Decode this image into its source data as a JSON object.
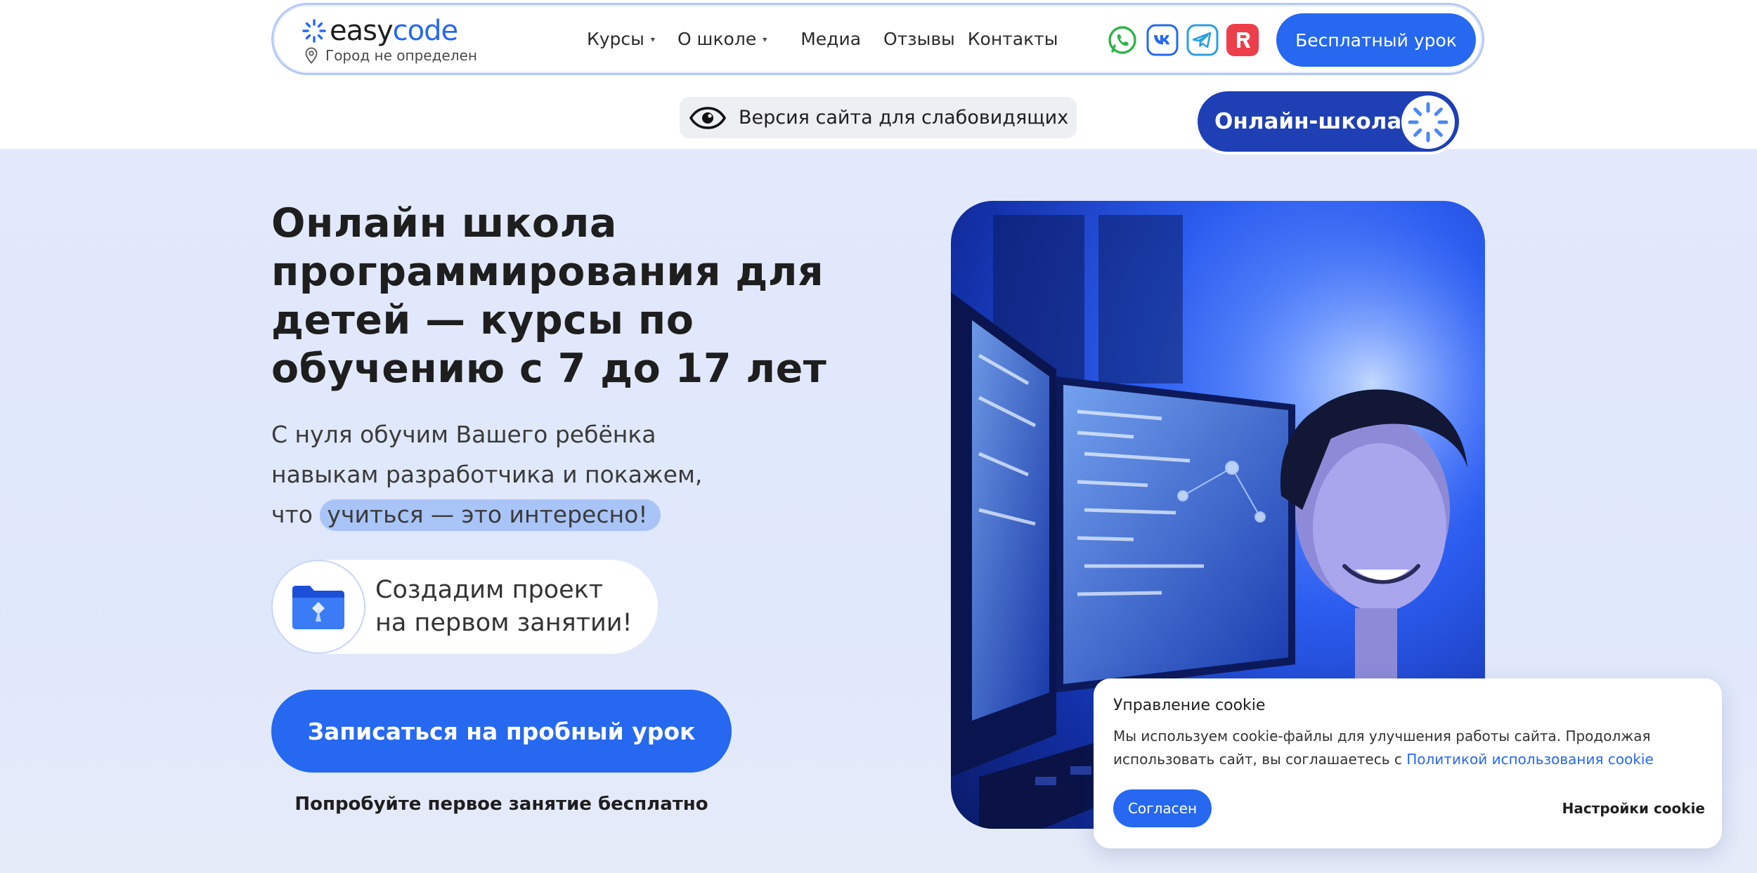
{
  "header": {
    "logo_easy": "easy",
    "logo_code": "code",
    "city": "Город не определен",
    "nav": [
      {
        "label": "Курсы",
        "dropdown": true
      },
      {
        "label": "О школе",
        "dropdown": true
      },
      {
        "label": "Медиа",
        "dropdown": false
      },
      {
        "label": "Отзывы",
        "dropdown": false
      },
      {
        "label": "Контакты",
        "dropdown": false
      }
    ],
    "nav_caret": "▾",
    "socials": [
      "whatsapp-icon",
      "vk-icon",
      "telegram-icon",
      "rutube-icon"
    ],
    "cta": "Бесплатный урок"
  },
  "accessibility": {
    "label": "Версия сайта для слабовидящих"
  },
  "hero": {
    "title": "Онлайн школа программирования для детей — курсы по обучению с 7 до 17 лет",
    "subtitle_line1": "С нуля обучим Вашего ребёнка",
    "subtitle_line2": "навыкам разработчика и покажем,",
    "subtitle_prefix": "что",
    "subtitle_highlight": "учиться — это интересно!",
    "project_line1": "Создадим проект",
    "project_line2": "на первом занятии!",
    "cta": "Записаться на пробный урок",
    "note": "Попробуйте первое занятие бесплатно",
    "badge": "Онлайн-школа"
  },
  "cookie": {
    "title": "Управление cookie",
    "text": "Мы используем cookie-файлы для улучшения работы сайта. Продолжая использовать сайт, вы соглашаетесь с",
    "link": "Политикой использования cookie",
    "accept": "Согласен",
    "settings": "Настройки cookie"
  },
  "colors": {
    "accent": "#2668f0",
    "hero_bg": "#e3e9fb",
    "highlight": "#a9c4f7"
  }
}
